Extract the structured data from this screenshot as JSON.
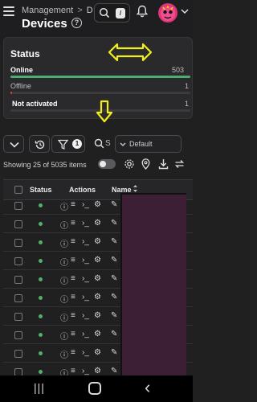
{
  "header": {
    "breadcrumb_root": "Management",
    "breadcrumb_sep": ">",
    "breadcrumb_current": "D",
    "title": "Devices",
    "help_symbol": "?",
    "search_shortcut": "/"
  },
  "status_card": {
    "title": "Status",
    "rows": [
      {
        "label": "Online",
        "value": "503",
        "fill_fraction": 1.0,
        "color": "#4cae6e"
      },
      {
        "label": "Offline",
        "value": "1",
        "fill_fraction": 0.01,
        "color": "#e04040"
      },
      {
        "label": "Not activated",
        "value": "1",
        "fill_fraction": 0.0,
        "color": "#3b3b3d"
      }
    ]
  },
  "toolbar": {
    "filter_count": "1",
    "search_placeholder": "S",
    "default_select": "Default"
  },
  "summary": {
    "showing_text": "Showing 25 of 5035 items"
  },
  "table": {
    "columns": [
      "Status",
      "Actions",
      "Name"
    ],
    "row_count_visible": 10,
    "status_color": "#51b06a",
    "action_glyphs": [
      "ⓘ",
      "≡",
      "›_",
      "⚙",
      "✎"
    ]
  },
  "annotations": {
    "arrow_color": "#f2ee1a"
  },
  "navbar": {
    "recent_symbol": "|||",
    "back_symbol": "‹"
  }
}
